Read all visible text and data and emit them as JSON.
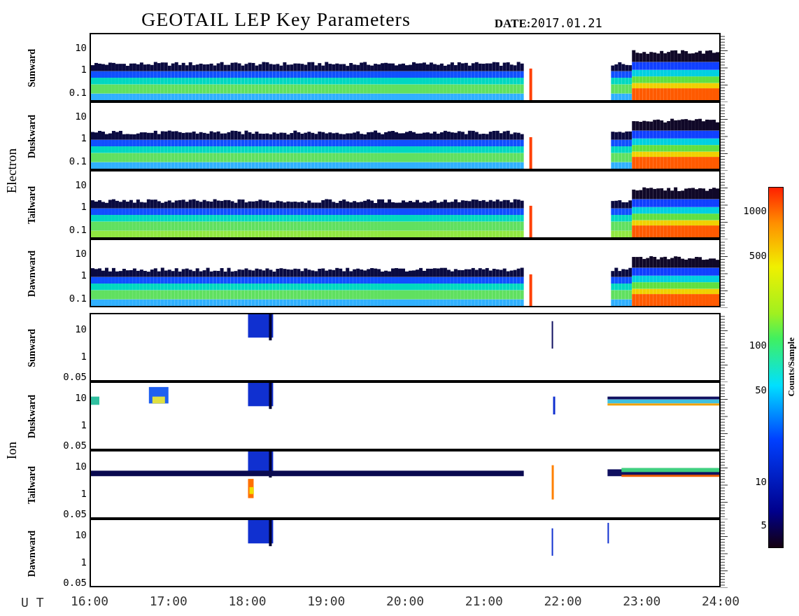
{
  "title": "GEOTAIL LEP Key Parameters",
  "date": {
    "label": "DATE:",
    "value": "2017.01.21"
  },
  "groups": [
    {
      "name": "Electron",
      "kind": "electron",
      "panels": [
        {
          "direction": "Sunward",
          "yticks": [
            "10",
            "1",
            "0.1"
          ]
        },
        {
          "direction": "Duskward",
          "yticks": [
            "10",
            "1",
            "0.1"
          ]
        },
        {
          "direction": "Tailward",
          "yticks": [
            "10",
            "1",
            "0.1"
          ]
        },
        {
          "direction": "Dawnward",
          "yticks": [
            "10",
            "1",
            "0.1"
          ]
        }
      ]
    },
    {
      "name": "Ion",
      "kind": "ion",
      "panels": [
        {
          "direction": "Sunward",
          "yticks": [
            "10",
            "1",
            "0.05"
          ]
        },
        {
          "direction": "Duskward",
          "yticks": [
            "10",
            "1",
            "0.05"
          ]
        },
        {
          "direction": "Tailward",
          "yticks": [
            "10",
            "1",
            "0.05"
          ]
        },
        {
          "direction": "Dawnward",
          "yticks": [
            "10",
            "1",
            "0.05"
          ]
        }
      ]
    }
  ],
  "xaxis": {
    "label": "U T",
    "ticks": [
      "16:00",
      "17:00",
      "18:00",
      "19:00",
      "20:00",
      "21:00",
      "22:00",
      "23:00",
      "24:00"
    ]
  },
  "colorbar": {
    "title": "Counts/Sample",
    "ticks": [
      "1000",
      "500",
      "100",
      "50",
      "10",
      "5"
    ]
  }
}
